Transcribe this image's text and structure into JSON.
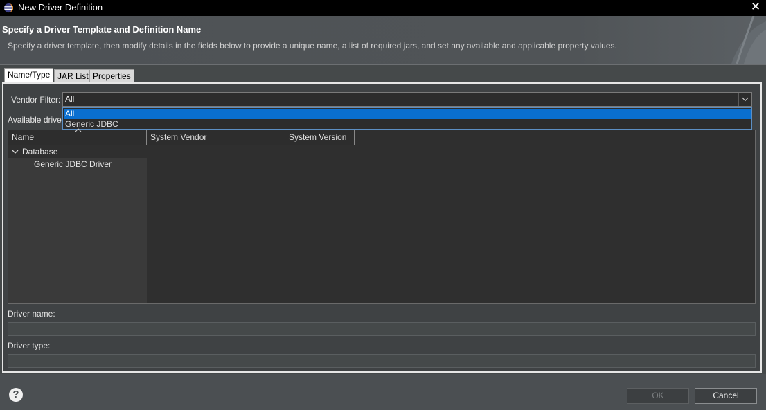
{
  "window": {
    "title": "New Driver Definition",
    "close_glyph": "✕"
  },
  "header": {
    "title": "Specify a Driver Template and Definition Name",
    "description": "Specify a driver template, then modify details in the fields below to provide a unique name, a list of required jars, and set any available and applicable property values."
  },
  "tabs": [
    {
      "label": "Name/Type",
      "active": true
    },
    {
      "label": "JAR List",
      "active": false
    },
    {
      "label": "Properties",
      "active": false
    }
  ],
  "vendor_filter": {
    "label": "Vendor Filter:",
    "value": "All",
    "options": [
      "All",
      "Generic JDBC"
    ],
    "selected_option": "All"
  },
  "available_label": "Available driver",
  "table": {
    "columns": [
      "Name",
      "System Vendor",
      "System Version"
    ],
    "tree": {
      "category": "Database",
      "items": [
        "Generic JDBC Driver"
      ]
    }
  },
  "driver_name_label": "Driver name:",
  "driver_type_label": "Driver type:",
  "footer": {
    "help_glyph": "?",
    "ok_label": "OK",
    "cancel_label": "Cancel"
  }
}
